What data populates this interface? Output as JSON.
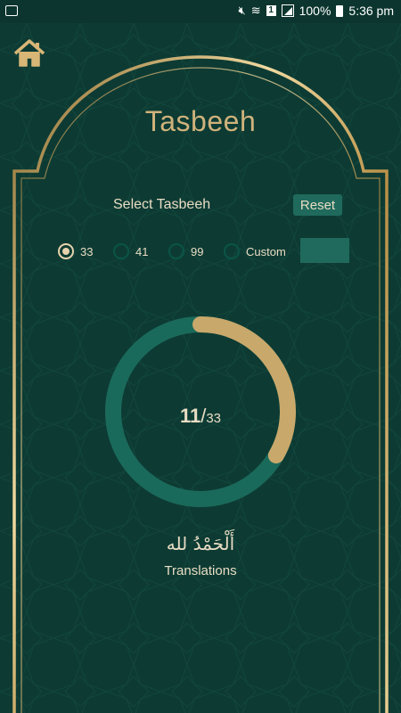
{
  "status_bar": {
    "sim_label": "1",
    "battery": "100%",
    "time": "5:36 pm"
  },
  "app": {
    "title": "Tasbeeh"
  },
  "controls": {
    "select_label": "Select Tasbeeh",
    "reset_label": "Reset",
    "options": [
      {
        "label": "33",
        "checked": true
      },
      {
        "label": "41",
        "checked": false
      },
      {
        "label": "99",
        "checked": false
      },
      {
        "label": "Custom",
        "checked": false
      }
    ],
    "custom_value": ""
  },
  "counter": {
    "count": "11",
    "target": "33",
    "progress": 0.3333
  },
  "dhikr": {
    "arabic": "أَلْحَمْدُ لله",
    "translations_label": "Translations"
  },
  "colors": {
    "background": "#0d3b33",
    "gold": "#cfb27b",
    "ring_track": "#1a6a5b",
    "ring_progress": "#c9a86b",
    "text": "#e8dcc4"
  }
}
